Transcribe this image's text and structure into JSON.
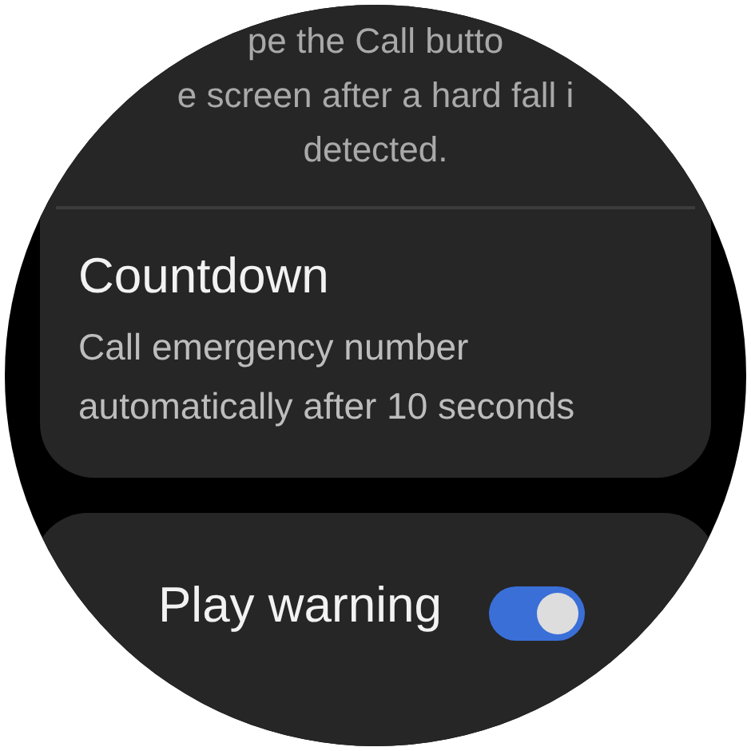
{
  "note": {
    "lines": [
      "pe the Call butto",
      "e screen after a hard fall i",
      "detected."
    ]
  },
  "settings": [
    {
      "kind": "text",
      "title": "Countdown",
      "description": "Call emergency number automatically after 10 seconds"
    },
    {
      "kind": "toggle",
      "title": "Play warning",
      "on": true
    }
  ]
}
